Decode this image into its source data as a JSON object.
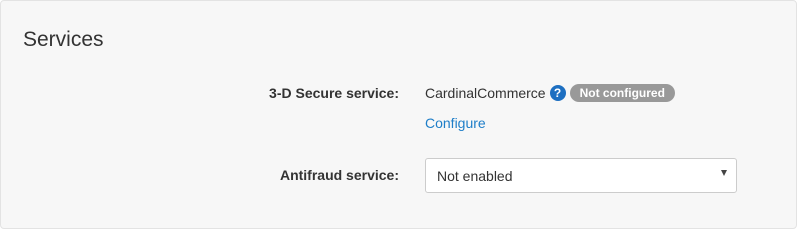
{
  "section": {
    "title": "Services"
  },
  "three_d_secure": {
    "label": "3-D Secure service:",
    "service_name": "CardinalCommerce",
    "help_icon_glyph": "?",
    "status_badge": "Not configured",
    "configure_link": "Configure",
    "icon": "help-circle-icon",
    "help_icon_color": "#1d6fc1",
    "badge_color": "#999999"
  },
  "antifraud": {
    "label": "Antifraud service:",
    "selected_value": "Not enabled",
    "caret_icon": "chevron-down-icon"
  },
  "colors": {
    "link": "#1e7ec8",
    "panel_background": "#f7f7f7"
  }
}
